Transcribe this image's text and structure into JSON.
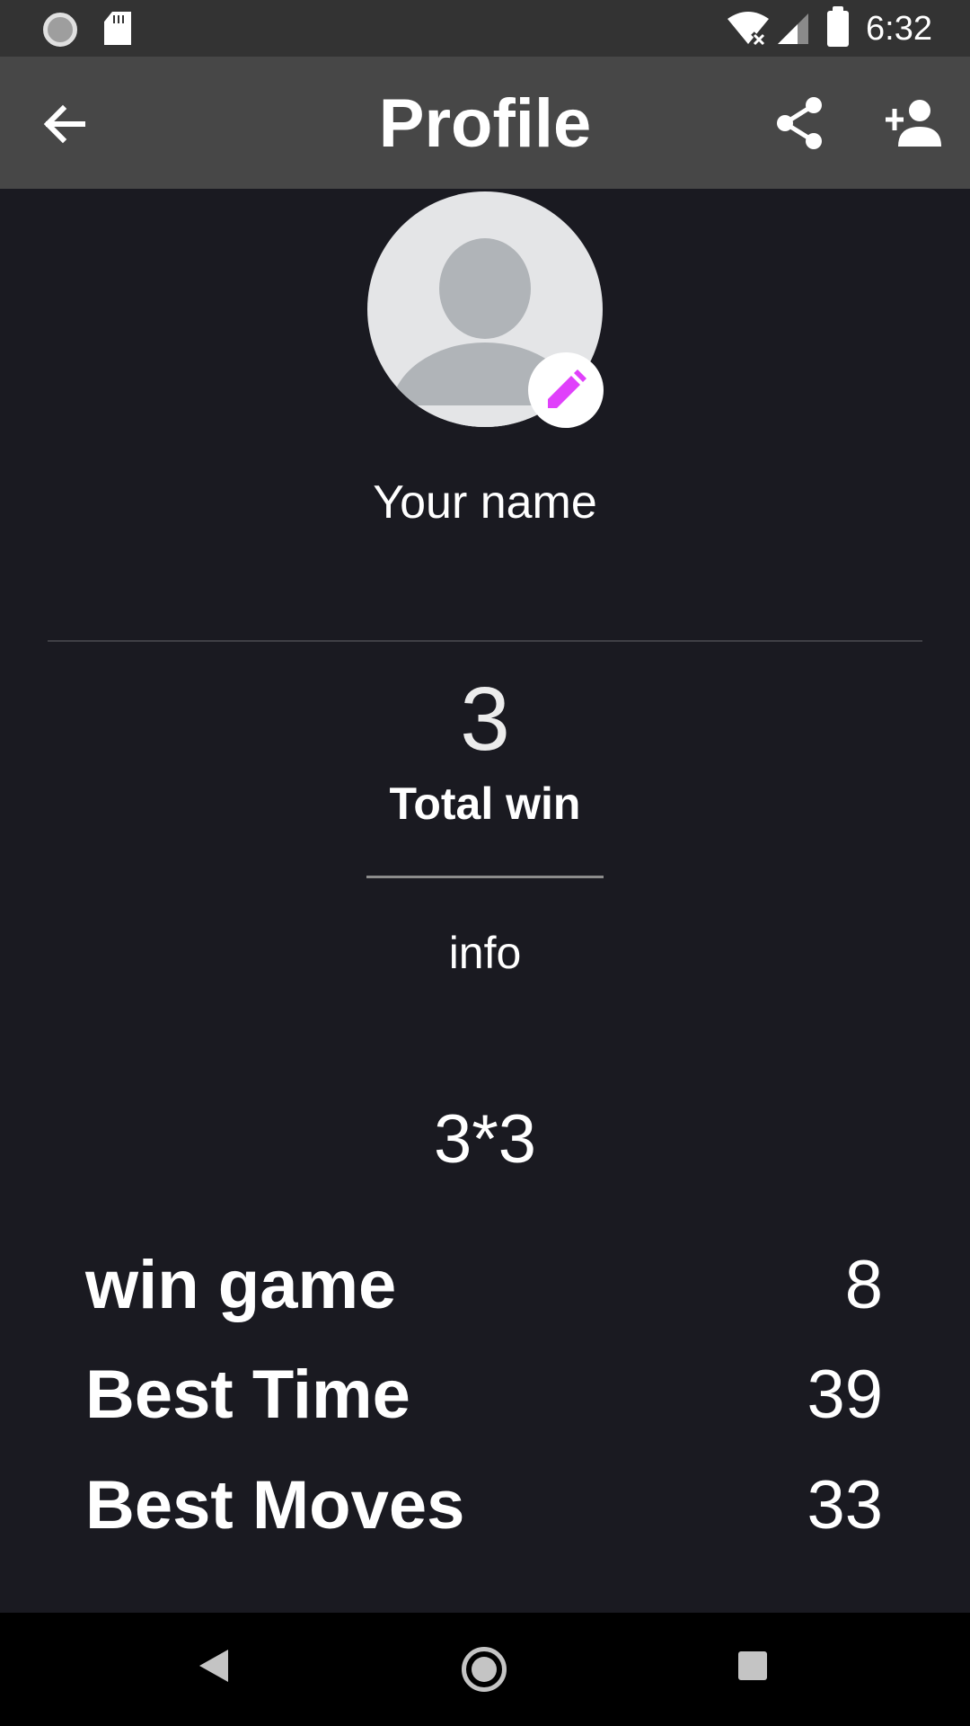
{
  "status_bar": {
    "time": "6:32"
  },
  "app_bar": {
    "title": "Profile",
    "icons": [
      "back-arrow-icon",
      "share-icon",
      "add-friend-icon"
    ]
  },
  "profile": {
    "name": "Your name",
    "edit_icon": "pencil-icon",
    "accent_color": "#e040fb"
  },
  "summary": {
    "total_win_count": "3",
    "total_win_label": "Total win",
    "info_label": "info"
  },
  "stats": {
    "grid_size": "3*3",
    "rows": [
      {
        "label": "win game",
        "value": "8"
      },
      {
        "label": "Best Time",
        "value": "39"
      },
      {
        "label": "Best Moves",
        "value": "33"
      }
    ]
  },
  "nav_bar": {
    "icons": [
      "nav-back-icon",
      "nav-home-icon",
      "nav-recents-icon"
    ]
  }
}
